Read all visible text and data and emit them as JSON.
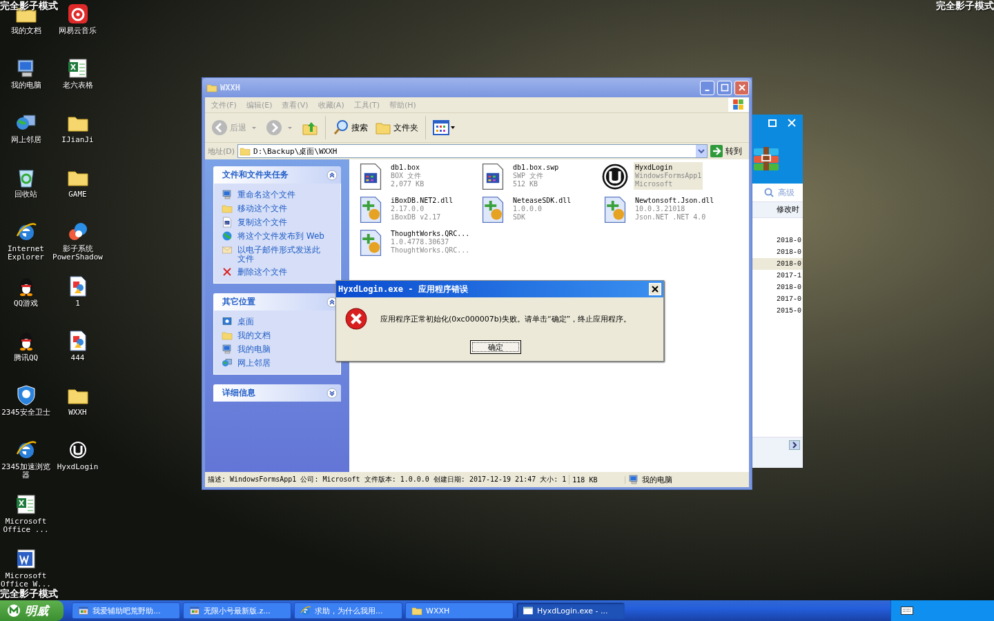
{
  "desktop_overlay": {
    "top_left": "完全影子模式",
    "top_right": "完全影子模式",
    "bottom_left": "完全影子模式"
  },
  "desktop_icons": [
    {
      "label": "我的文档",
      "kind": "folder"
    },
    {
      "label": "我的电脑",
      "kind": "computer"
    },
    {
      "label": "网上邻居",
      "kind": "network"
    },
    {
      "label": "回收站",
      "kind": "recycle"
    },
    {
      "label": "Internet Explorer",
      "kind": "browser"
    },
    {
      "label": "QQ游戏",
      "kind": "penguin"
    },
    {
      "label": "腾讯QQ",
      "kind": "penguin"
    },
    {
      "label": "2345安全卫士",
      "kind": "shield"
    },
    {
      "label": "2345加速浏览器",
      "kind": "browser"
    },
    {
      "label": "Microsoft Office ...",
      "kind": "spreadsheet"
    },
    {
      "label": "Microsoft Office W...",
      "kind": "word"
    },
    {
      "label": "网易云音乐",
      "kind": "music"
    },
    {
      "label": "老六表格",
      "kind": "spreadsheet"
    },
    {
      "label": "IJianJi",
      "kind": "folder"
    },
    {
      "label": "GAME",
      "kind": "folder"
    },
    {
      "label": "影子系统 PowerShadow",
      "kind": "swirl"
    },
    {
      "label": "1",
      "kind": "image"
    },
    {
      "label": "444",
      "kind": "image"
    },
    {
      "label": "WXXH",
      "kind": "folder"
    },
    {
      "label": "HyxdLogin",
      "kind": "logo"
    }
  ],
  "background_window": {
    "search_button": "高级",
    "column_header": "修改时",
    "rows": [
      {
        "date": "2018-0",
        "selected": false
      },
      {
        "date": "2018-0",
        "selected": false
      },
      {
        "date": "2018-0",
        "selected": true
      },
      {
        "date": "2017-1",
        "selected": false
      },
      {
        "date": "2018-0",
        "selected": false
      },
      {
        "date": "2017-0",
        "selected": false
      },
      {
        "date": "2015-0",
        "selected": false
      }
    ]
  },
  "explorer": {
    "title": "WXXH",
    "menu": [
      "文件(F)",
      "编辑(E)",
      "查看(V)",
      "收藏(A)",
      "工具(T)",
      "帮助(H)"
    ],
    "toolbar": {
      "back": {
        "label": "后退",
        "disabled": true
      },
      "search": "搜索",
      "folders": "文件夹"
    },
    "address": {
      "label": "地址(D)",
      "path": "D:\\Backup\\桌面\\WXXH",
      "go": "转到"
    },
    "task_panels": [
      {
        "title": "文件和文件夹任务",
        "expanded": true,
        "items": [
          {
            "label": "重命名这个文件",
            "kind": "computer"
          },
          {
            "label": "移动这个文件",
            "kind": "folder"
          },
          {
            "label": "复制这个文件",
            "kind": "document"
          },
          {
            "label": "将这个文件发布到 Web",
            "kind": "globe"
          },
          {
            "label": "以电子邮件形式发送此文件",
            "kind": "mail"
          },
          {
            "label": "删除这个文件",
            "kind": "cross"
          }
        ]
      },
      {
        "title": "其它位置",
        "expanded": true,
        "items": [
          {
            "label": "桌面",
            "kind": "desktop"
          },
          {
            "label": "我的文档",
            "kind": "folder"
          },
          {
            "label": "我的电脑",
            "kind": "computer"
          },
          {
            "label": "网上邻居",
            "kind": "network"
          }
        ]
      },
      {
        "title": "详细信息",
        "expanded": false
      }
    ],
    "files": [
      {
        "name": "db1.box",
        "line2": "BOX 文件",
        "line3": "2,077 KB",
        "kind": "document",
        "selected": false
      },
      {
        "name": "db1.box.swp",
        "line2": "SWP 文件",
        "line3": "512 KB",
        "kind": "document",
        "selected": false
      },
      {
        "name": "HyxdLogin",
        "line2": "WindowsFormsApp1",
        "line3": "Microsoft",
        "kind": "logo",
        "selected": true
      },
      {
        "name": "iBoxDB.NET2.dll",
        "line2": "2.17.0.0",
        "line3": "iBoxDB v2.17",
        "kind": "dll",
        "selected": false
      },
      {
        "name": "NeteaseSDK.dll",
        "line2": "1.0.0.0",
        "line3": "SDK",
        "kind": "dll",
        "selected": false
      },
      {
        "name": "Newtonsoft.Json.dll",
        "line2": "10.0.3.21018",
        "line3": "Json.NET .NET 4.0",
        "kind": "dll",
        "selected": false
      },
      {
        "name": "ThoughtWorks.QRC...",
        "line2": "1.0.4778.30637",
        "line3": "ThoughtWorks.QRC...",
        "kind": "dll",
        "selected": false
      }
    ],
    "status_bar": {
      "details": "描述: WindowsFormsApp1 公司: Microsoft 文件版本: 1.0.0.0 创建日期: 2017-12-19 21:47 大小: 1",
      "size": "118 KB",
      "location": "我的电脑"
    }
  },
  "dialog": {
    "title": "HyxdLogin.exe - 应用程序错误",
    "message": "应用程序正常初始化(0xc000007b)失败。请单击“确定”，终止应用程序。",
    "button": "确定"
  },
  "taskbar": {
    "start": "明威",
    "tasks": [
      {
        "label": "我爱辅助吧荒野助...",
        "kind": "app",
        "selected": false
      },
      {
        "label": "无限小号最新版.z...",
        "kind": "app",
        "selected": false
      },
      {
        "label": "求助，为什么我用...",
        "kind": "browser",
        "selected": false
      },
      {
        "label": "WXXH",
        "kind": "folder",
        "selected": false
      },
      {
        "label": "HyxdLogin.exe - ...",
        "kind": "window",
        "selected": true
      }
    ]
  }
}
